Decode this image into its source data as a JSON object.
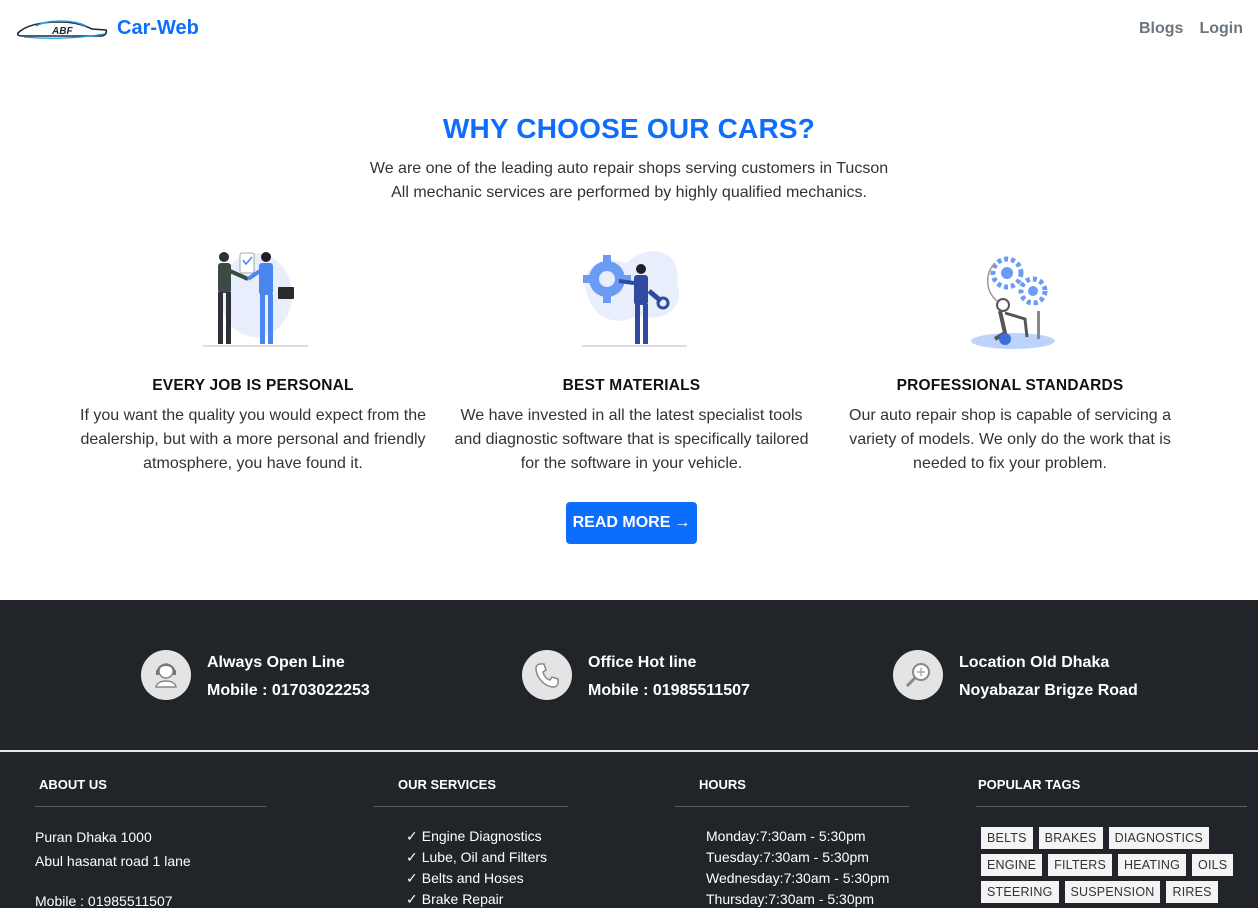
{
  "nav": {
    "brand": "Car-Web",
    "links": [
      "Blogs",
      "Login"
    ]
  },
  "hero": {
    "title": "WHY CHOOSE OUR CARS?",
    "subtitle_line1": "We are one of the leading auto repair shops serving customers in Tucson",
    "subtitle_line2": "All mechanic services are performed by highly qualified mechanics."
  },
  "features": [
    {
      "icon": "handshake-illustration",
      "title": "EVERY JOB IS PERSONAL",
      "text": "If you want the quality you would expect from the dealership, but with a more personal and friendly atmosphere, you have found it."
    },
    {
      "icon": "mechanic-gear-illustration",
      "title": "BEST MATERIALS",
      "text": "We have invested in all the latest specialist tools and diagnostic software that is specifically tailored for the software in your vehicle."
    },
    {
      "icon": "gears-illustration",
      "title": "PROFESSIONAL STANDARDS",
      "text": "Our auto repair shop is capable of servicing a variety of models. We only do the work that is needed to fix your problem."
    }
  ],
  "read_more": {
    "label": "READ MORE",
    "arrow": "→"
  },
  "contacts": [
    {
      "icon": "headset-icon",
      "line1": "Always Open Line",
      "line2": "Mobile : 01703022253"
    },
    {
      "icon": "phone-icon",
      "line1": "Office Hot line",
      "line2": "Mobile : 01985511507"
    },
    {
      "icon": "location-search-icon",
      "line1": "Location Old Dhaka",
      "line2": "Noyabazar Brigze Road"
    }
  ],
  "footer": {
    "about": {
      "title": "ABOUT US",
      "lines": [
        "Puran Dhaka 1000",
        "Abul hasanat road 1 lane",
        "Mobile : 01985511507"
      ]
    },
    "services": {
      "title": "OUR SERVICES",
      "check": "✓",
      "items": [
        "Engine Diagnostics",
        "Lube, Oil and Filters",
        "Belts and Hoses",
        "Brake Repair"
      ]
    },
    "hours": {
      "title": "HOURS",
      "items": [
        "Monday:7:30am - 5:30pm",
        "Tuesday:7:30am - 5:30pm",
        "Wednesday:7:30am - 5:30pm",
        "Thursday:7:30am - 5:30pm"
      ]
    },
    "tags": {
      "title": "POPULAR TAGS",
      "rows": [
        [
          "BELTS",
          "BRAKES",
          "DIAGNOSTICS"
        ],
        [
          "ENGINE",
          "FILTERS",
          "HEATING",
          "OILS"
        ],
        [
          "STEERING",
          "SUSPENSION",
          "RIRES"
        ]
      ]
    }
  },
  "colors": {
    "primary": "#0d6efd",
    "dark": "#212529",
    "muted": "#6c757d"
  }
}
